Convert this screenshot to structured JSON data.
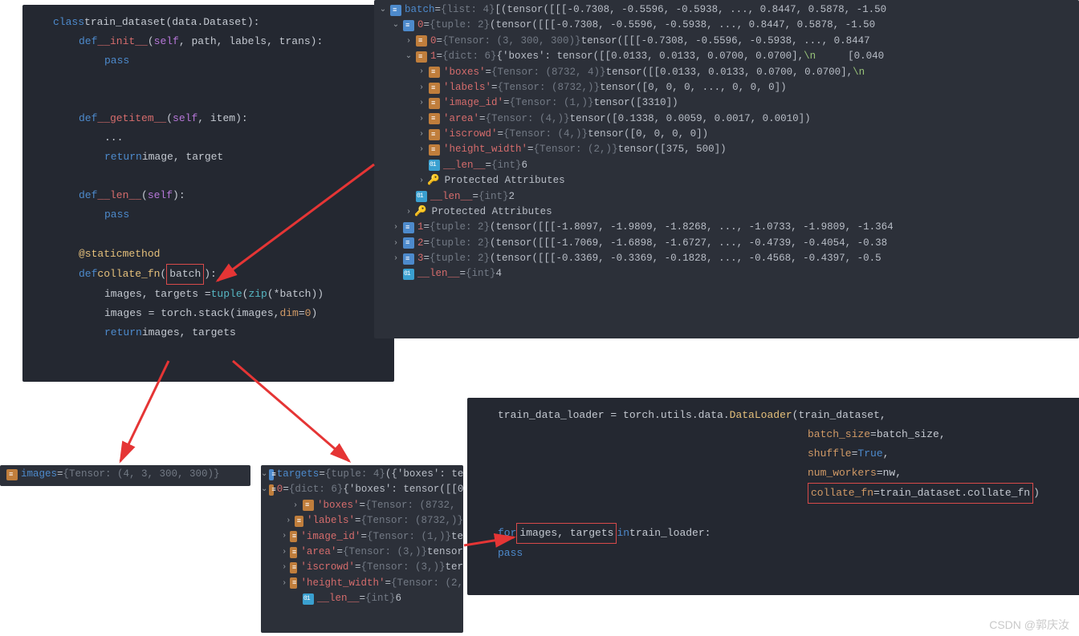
{
  "code_top": {
    "l1p": "class ",
    "l1n": "train_dataset",
    "l1r": "(data.Dataset):",
    "l2d": "def ",
    "l2f": "__init__",
    "l2a": "(",
    "l2s": "self",
    "l2c": ", path, labels, trans):",
    "l3": "pass",
    "l5d": "def ",
    "l5f": "__getitem__",
    "l5a": "(",
    "l5s": "self",
    "l5c": ", item):",
    "l6": "...",
    "l7r": "return ",
    "l7v": "image, target",
    "l9d": "def ",
    "l9f": "__len__",
    "l9a": "(",
    "l9s": "self",
    "l9c": "):",
    "l10": "pass",
    "l12": "@staticmethod",
    "l13d": "def ",
    "l13f": "collate_fn",
    "l13a": "(",
    "l13p": "batch",
    "l13c": "):",
    "l14": "images, targets = ",
    "l14t": "tuple",
    "l14z": "(",
    "l14zip": "zip",
    "l14r": "(*batch))",
    "l15": "images = torch.stack(images, ",
    "l15d": "dim",
    "l15e": "=",
    "l15v": "0",
    "l15c": ")",
    "l16r": "return ",
    "l16v": "images, targets"
  },
  "debug_main": {
    "batch": {
      "name": "batch",
      "type": "{list: 4}",
      "val": "[(tensor([[[-0.7308, -0.5596, -0.5938,  ...,  0.8447,  0.5878, -1.50"
    },
    "i0": {
      "name": "0",
      "type": "{tuple: 2}",
      "val": "(tensor([[[-0.7308, -0.5596, -0.5938,  ...,  0.8447,  0.5878, -1.50"
    },
    "t0": {
      "name": "0",
      "type": "{Tensor: (3, 300, 300)}",
      "val": "tensor([[[-0.7308, -0.5596, -0.5938,  ...,  0.8447"
    },
    "d1": {
      "name": "1",
      "type": "{dict: 6}",
      "val": "{'boxes': tensor([[0.0133, 0.0133, 0.0700, 0.0700],",
      "nl": "\\n",
      "ext": "[0.040"
    },
    "boxes": {
      "name": "'boxes'",
      "type": "{Tensor: (8732, 4)}",
      "val": "tensor([[0.0133, 0.0133, 0.0700, 0.0700],",
      "nl": "\\n"
    },
    "labels": {
      "name": "'labels'",
      "type": "{Tensor: (8732,)}",
      "val": "tensor([0, 0, 0,  ..., 0, 0, 0])"
    },
    "image_id": {
      "name": "'image_id'",
      "type": "{Tensor: (1,)}",
      "val": "tensor([3310])"
    },
    "area": {
      "name": "'area'",
      "type": "{Tensor: (4,)}",
      "val": "tensor([0.1338, 0.0059, 0.0017, 0.0010])"
    },
    "iscrowd": {
      "name": "'iscrowd'",
      "type": "{Tensor: (4,)}",
      "val": "tensor([0, 0, 0, 0])"
    },
    "hw": {
      "name": "'height_width'",
      "type": "{Tensor: (2,)}",
      "val": "tensor([375, 500])"
    },
    "len6": {
      "name": "__len__",
      "type": "{int}",
      "val": "6"
    },
    "prot": "Protected Attributes",
    "len2": {
      "name": "__len__",
      "type": "{int}",
      "val": "2"
    },
    "i1": {
      "name": "1",
      "type": "{tuple: 2}",
      "val": "(tensor([[[-1.8097, -1.9809, -1.8268,  ..., -1.0733, -1.9809, -1.364"
    },
    "i2": {
      "name": "2",
      "type": "{tuple: 2}",
      "val": "(tensor([[[-1.7069, -1.6898, -1.6727,  ..., -0.4739, -0.4054, -0.38"
    },
    "i3": {
      "name": "3",
      "type": "{tuple: 2}",
      "val": "(tensor([[[-0.3369, -0.3369, -0.1828,  ..., -0.4568, -0.4397, -0.5"
    },
    "len4": {
      "name": "__len__",
      "type": "{int}",
      "val": "4"
    }
  },
  "images_popup": {
    "name": "images",
    "type": "{Tensor: (4, 3, 300, 300)}"
  },
  "targets_popup": {
    "targets": {
      "name": "targets",
      "type": "{tuple: 4}",
      "val": "({'boxes': tens"
    },
    "i0": {
      "name": "0",
      "type": "{dict: 6}",
      "val": "{'boxes': tensor([[0"
    },
    "boxes": {
      "name": "'boxes'",
      "type": "{Tensor: (8732,"
    },
    "labels": {
      "name": "'labels'",
      "type": "{Tensor: (8732,)}"
    },
    "image_id": {
      "name": "'image_id'",
      "type": "{Tensor: (1,)}",
      "val": "te"
    },
    "area": {
      "name": "'area'",
      "type": "{Tensor: (3,)}",
      "val": "tensor"
    },
    "iscrowd": {
      "name": "'iscrowd'",
      "type": "{Tensor: (3,)}",
      "val": "ter"
    },
    "hw": {
      "name": "'height_width'",
      "type": "{Tensor: (2,"
    },
    "len6": {
      "name": "__len__",
      "type": "{int}",
      "val": "6"
    }
  },
  "code_right": {
    "l1": "train_data_loader = torch.utils.data.",
    "l1b": "DataLoader",
    "l1c": "(train_dataset,",
    "l2k": "batch_size",
    "l2v": "=batch_size,",
    "l3k": "shuffle",
    "l3e": "=",
    "l3v": "True",
    "l3c": ",",
    "l4k": "num_workers",
    "l4v": "=nw,",
    "l5k": "collate_fn",
    "l5v": "=train_dataset.collate_fn",
    "l7f": "for ",
    "l7i": "images, targets",
    "l7r": " in ",
    "l7l": "train_loader:",
    "l8": "pass"
  },
  "watermark": "CSDN @郭庆汝"
}
